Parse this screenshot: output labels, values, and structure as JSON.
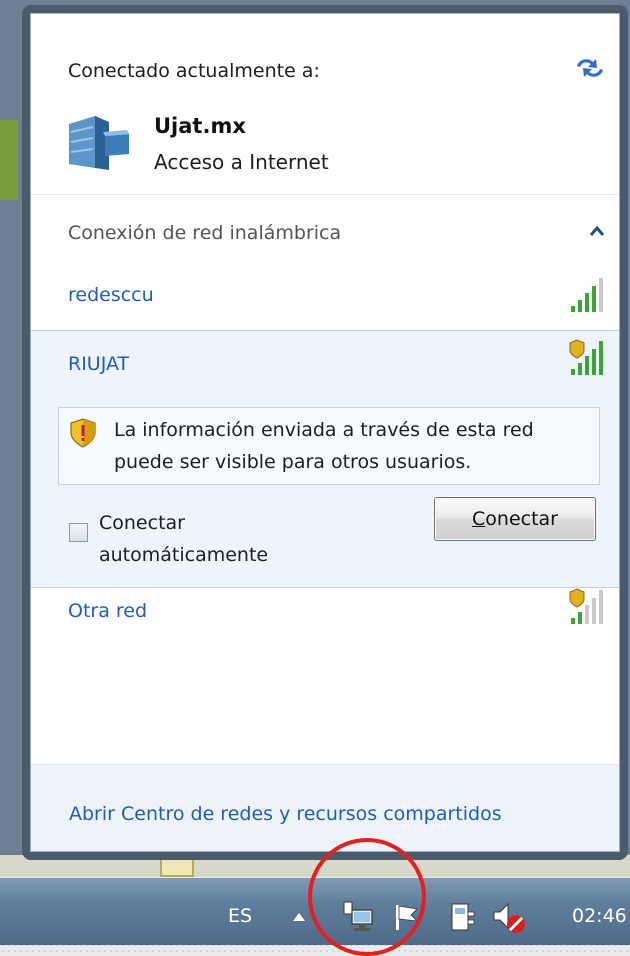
{
  "flyout": {
    "header": "Conectado actualmente a:",
    "refresh_icon": "refresh-arrows-icon",
    "current_network": {
      "name": "Ujat.mx",
      "status": "Acceso a Internet",
      "icon": "network-server-icon"
    },
    "section_title": "Conexión de red inalámbrica",
    "networks": [
      {
        "name": "redesccu",
        "secured": false,
        "signal_bars": 4,
        "signal_max": 5
      },
      {
        "name": "RIUJAT",
        "secured": true,
        "signal_bars": 5,
        "signal_max": 5,
        "selected": true
      },
      {
        "name": "Otra red",
        "secured": true,
        "signal_bars": 2,
        "signal_max": 5
      }
    ],
    "selected_details": {
      "warning": "La información enviada a través de esta red puede ser visible para otros usuarios.",
      "auto_connect_label": "Conectar automáticamente",
      "auto_connect_checked": false,
      "connect_button_label": "Conectar",
      "connect_access_key": "C"
    },
    "footer_link": "Abrir Centro de redes y recursos compartidos"
  },
  "taskbar": {
    "language": "ES",
    "clock": "02:46",
    "tray_icons": [
      "show-hidden-icons-arrow",
      "network-icon",
      "action-center-flag-icon",
      "power-plug-icon",
      "volume-muted-icon"
    ]
  },
  "colors": {
    "link_blue": "#1f5db8",
    "selection_bg": "#eef4fb",
    "highlight_ring": "#e32020",
    "signal_green": "#3aa33a"
  }
}
